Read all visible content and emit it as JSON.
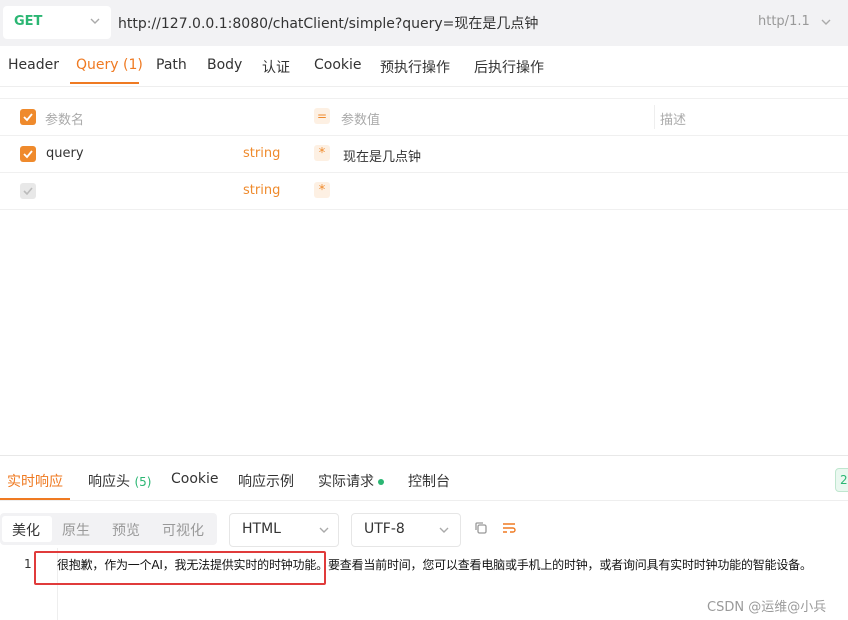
{
  "request": {
    "method": "GET",
    "url": "http://127.0.0.1:8080/chatClient/simple?query=现在是几点钟",
    "protocol": "http/1.1"
  },
  "request_tabs": [
    {
      "label": "Header"
    },
    {
      "label": "Query (1)"
    },
    {
      "label": "Path"
    },
    {
      "label": "Body"
    },
    {
      "label": "认证"
    },
    {
      "label": "Cookie"
    },
    {
      "label": "预执行操作"
    },
    {
      "label": "后执行操作"
    }
  ],
  "params": {
    "header": {
      "name": "参数名",
      "value": "参数值",
      "desc": "描述"
    },
    "rows": [
      {
        "name": "query",
        "type": "string",
        "value": "现在是几点钟",
        "checked": true
      },
      {
        "name": "",
        "type": "string",
        "value": "",
        "checked": false
      }
    ]
  },
  "response_tabs": [
    {
      "label": "实时响应"
    },
    {
      "label": "响应头"
    },
    {
      "label": "(5)"
    },
    {
      "label": "Cookie"
    },
    {
      "label": "响应示例"
    },
    {
      "label": "实际请求"
    },
    {
      "label": "控制台"
    }
  ],
  "view_modes": [
    "美化",
    "原生",
    "预览",
    "可视化"
  ],
  "format_select": "HTML",
  "encoding_select": "UTF-8",
  "code": {
    "line_number": "1",
    "text": "很抱歉，作为一个AI，我无法提供实时的时钟功能。要查看当前时间，您可以查看电脑或手机上的时钟，或者询问具有实时时钟功能的智能设备。"
  },
  "watermark": "CSDN @运维@小兵",
  "colors": {
    "accent": "#ef7a22",
    "green": "#2bb673",
    "highlight": "#e03b3b"
  }
}
